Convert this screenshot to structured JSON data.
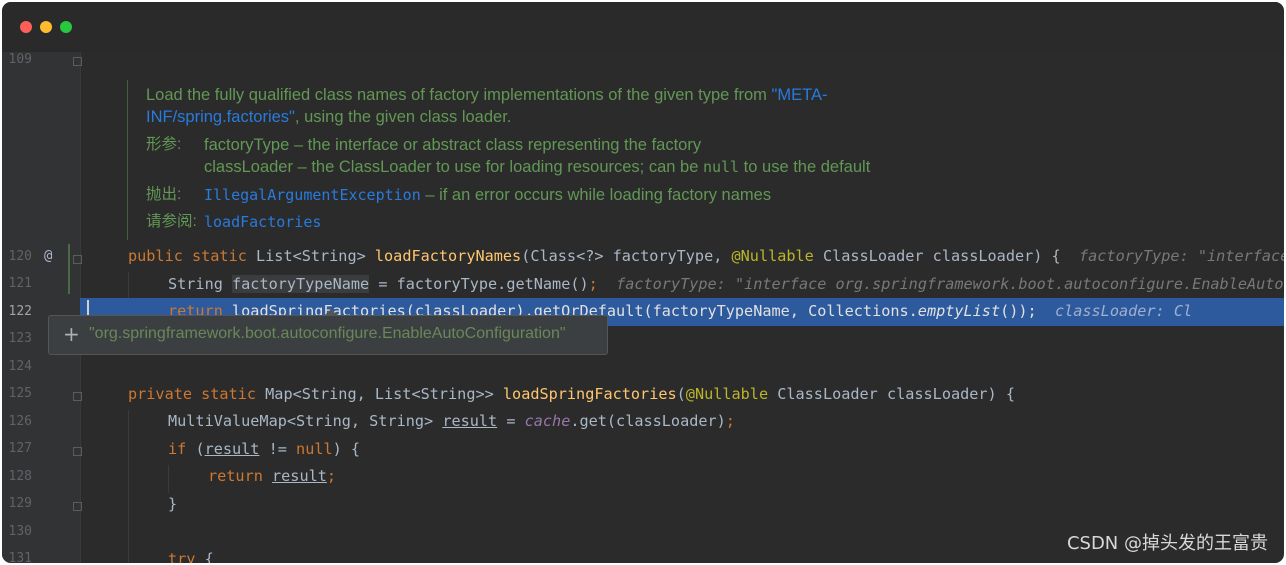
{
  "window": {
    "controls": {
      "close_color": "#ff5f57",
      "minimize_color": "#febc2e",
      "maximize_color": "#28c840"
    }
  },
  "editor": {
    "line_numbers": [
      "109",
      "120",
      "121",
      "122",
      "123",
      "124",
      "125",
      "126",
      "127",
      "128",
      "129",
      "130",
      "131"
    ],
    "gutter_marker": "@",
    "javadoc": {
      "desc_line1_a": "Load the fully qualified class names of factory implementations of the given type from ",
      "desc_line1_b": "\"META-",
      "desc_line2_a": "INF/spring.factories\"",
      "desc_line2_b": ", using the given class loader.",
      "params_label": "形参:",
      "param1": "factoryType – the interface or abstract class representing the factory",
      "param2_a": "classLoader – the ClassLoader to use for loading resources; can be ",
      "param2_code": "null",
      "param2_b": " to use the default",
      "throws_label": "抛出:",
      "throws_type": "IllegalArgumentException",
      "throws_desc": " – if an error occurs while loading factory names",
      "see_label": "请参阅:",
      "see_link": "loadFactories"
    },
    "code": {
      "l120": {
        "kw": "public static ",
        "type": "List<String> ",
        "method": "loadFactoryNames",
        "p1": "(Class<?> factoryType, ",
        "ann": "@Nullable ",
        "p2": "ClassLoader classLoader) {",
        "hint": "factoryType: \"interface org.springframework.boot.autoconfigure.Enab"
      },
      "l121": {
        "a": "String ",
        "var": "factoryTypeName",
        "b": " = factoryType.getName()",
        "semi": ";",
        "hint": "factoryType: \"interface org.springframework.boot.autoconfigure.EnableAutoCon"
      },
      "l122": {
        "kw": "return ",
        "a": "loadSpringFactories(classLoader).getOrDefault(factoryTypeName, Collections.",
        "call": "emptyList",
        "b": "());",
        "hint": "classLoader: Cl"
      },
      "l123": {
        "a": "}"
      },
      "l125": {
        "kw": "private static ",
        "type": "Map<String, List<String>> ",
        "method": "loadSpringFactories",
        "p1": "(",
        "ann": "@Nullable ",
        "p2": "ClassLoader classLoader) {"
      },
      "l126": {
        "a": "MultiValueMap<String, String> ",
        "var": "result",
        "b": " = ",
        "field": "cache",
        "c": ".get(classLoader)",
        "semi": ";"
      },
      "l127": {
        "kw": "if ",
        "a": "(",
        "var": "result",
        "b": " != ",
        "kw2": "null",
        "c": ") {"
      },
      "l128": {
        "kw": "return ",
        "var": "result",
        "semi": ";"
      },
      "l129": {
        "a": "}"
      },
      "l131": {
        "kw": "try ",
        "a": "{"
      }
    },
    "popup": {
      "icon": "plus-icon",
      "text": "\"org.springframework.boot.autoconfigure.EnableAutoConfiguration\""
    }
  },
  "watermark": "CSDN @掉头发的王富贵"
}
